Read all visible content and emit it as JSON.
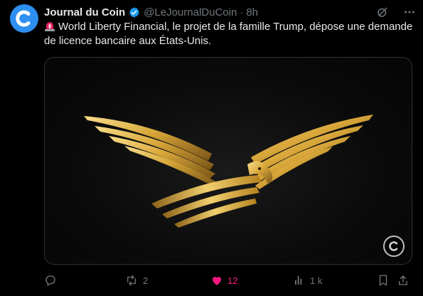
{
  "tweet": {
    "author_name": "Journal du Coin",
    "handle": "@LeJournalDuCoin",
    "separator": "·",
    "time": "8h",
    "text": "World Liberty Financial, le projet de la famille Trump, dépose une demande de licence bancaire aux États-Unis.",
    "verified": true
  },
  "media": {
    "description_icon": "golden-eagle-wings-emblem"
  },
  "actions": {
    "reply_count": "",
    "repost_count": "2",
    "like_count": "12",
    "views_count": "1 k"
  },
  "colors": {
    "background": "#000000",
    "text": "#e7e9ea",
    "muted": "#71767b",
    "verified": "#1d9bf0",
    "like": "#f91880",
    "avatar": "#2d8ff0"
  },
  "icons": [
    "grok-icon",
    "more-icon",
    "reply-icon",
    "repost-icon",
    "like-icon",
    "views-icon",
    "bookmark-icon",
    "share-icon"
  ]
}
